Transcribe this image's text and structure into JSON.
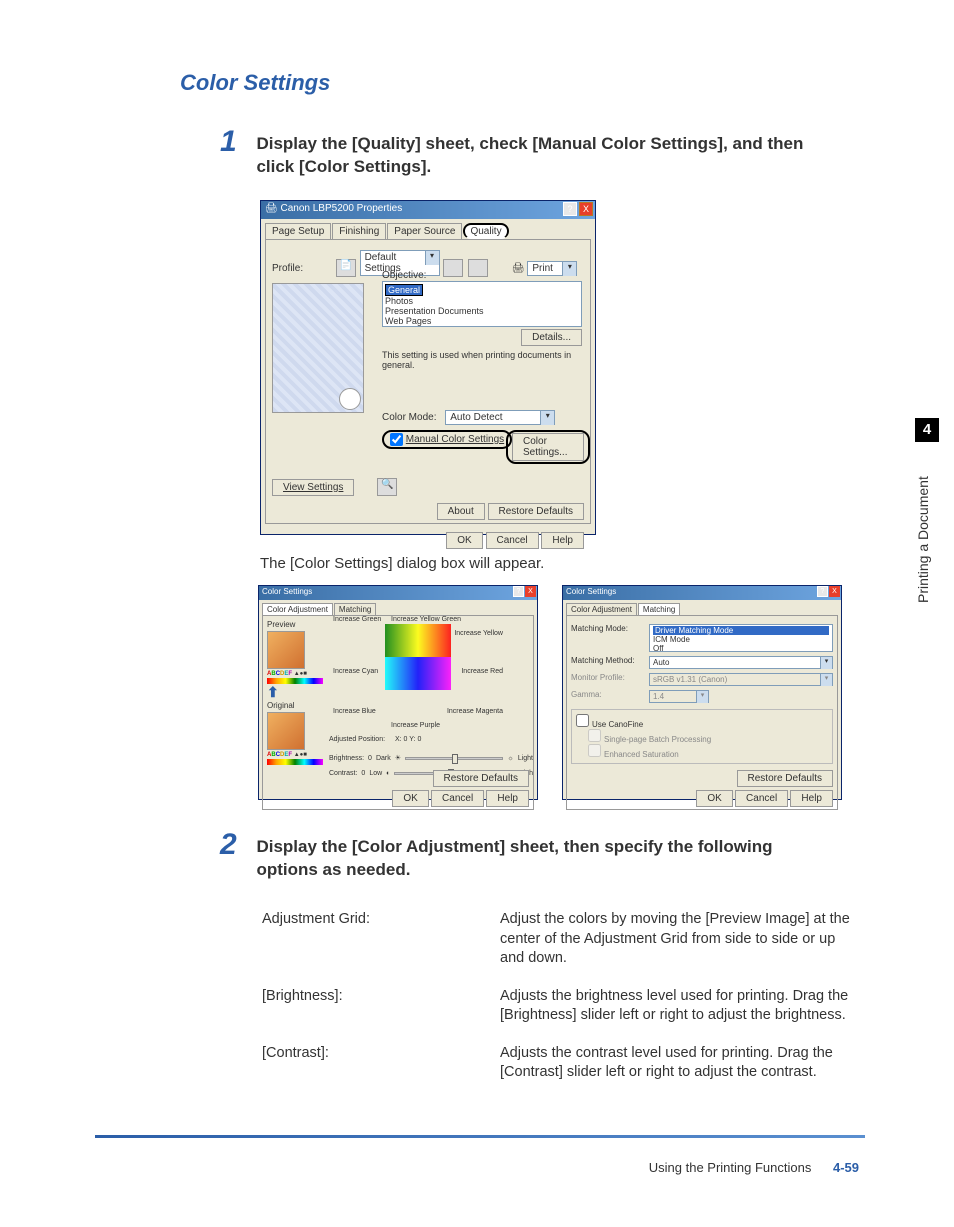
{
  "page_title": "Color Settings",
  "chapter_num": "4",
  "side_text": "Printing a Document",
  "step1": {
    "num": "1",
    "text": "Display the [Quality] sheet, check [Manual Color Settings], and then click [Color Settings]."
  },
  "dialog1": {
    "title": "Canon LBP5200 Properties",
    "help": "?",
    "close": "X",
    "tabs": {
      "page_setup": "Page Setup",
      "finishing": "Finishing",
      "paper_source": "Paper Source",
      "quality": "Quality"
    },
    "profile_label": "Profile:",
    "profile_value": "Default Settings",
    "print_label": "Print",
    "objective_label": "Objective:",
    "objective_items": {
      "general": "General",
      "photos": "Photos",
      "presentation": "Presentation Documents",
      "web": "Web Pages"
    },
    "details_btn": "Details...",
    "setting_note": "This setting is used when printing documents in general.",
    "colormode_label": "Color Mode:",
    "colormode_value": "Auto Detect",
    "manual_check": "Manual Color Settings",
    "colorsettings_btn": "Color Settings...",
    "view_settings": "View Settings",
    "about_btn": "About",
    "restore_btn": "Restore Defaults",
    "ok_btn": "OK",
    "cancel_btn": "Cancel",
    "help_btn": "Help"
  },
  "caption1": "The [Color Settings] dialog box will appear.",
  "ss1": {
    "title": "Color Settings",
    "tab_ca": "Color Adjustment",
    "tab_m": "Matching",
    "preview": "Preview",
    "original": "Original",
    "inc_yg": "Increase Yellow Green",
    "inc_green": "Increase Green",
    "inc_yellow": "Increase Yellow",
    "inc_cyan": "Increase Cyan",
    "inc_red": "Increase Red",
    "inc_blue": "Increase Blue",
    "inc_magenta": "Increase Magenta",
    "inc_purple": "Increase Purple",
    "adj_pos": "Adjusted Position:",
    "xy": "X: 0    Y: 0",
    "brightness": "Brightness:",
    "b_val": "0",
    "dark": "Dark",
    "light": "Light",
    "contrast": "Contrast:",
    "c_val": "0",
    "low": "Low",
    "high": "High",
    "restore": "Restore Defaults",
    "ok": "OK",
    "cancel": "Cancel",
    "help": "Help"
  },
  "ss2": {
    "title": "Color Settings",
    "tab_ca": "Color Adjustment",
    "tab_m": "Matching",
    "mmode": "Matching Mode:",
    "mmode_sel": "Driver Matching Mode",
    "mmode_2": "ICM Mode",
    "mmode_3": "Off",
    "mmethod": "Matching Method:",
    "mmethod_val": "Auto",
    "mprofile": "Monitor Profile:",
    "mprofile_val": "sRGB v1.31 (Canon)",
    "gamma": "Gamma:",
    "gamma_val": "1.4",
    "canofine": "Use CanoFine",
    "single": "Single-page Batch Processing",
    "enh": "Enhanced Saturation",
    "restore": "Restore Defaults",
    "ok": "OK",
    "cancel": "Cancel",
    "help": "Help"
  },
  "step2": {
    "num": "2",
    "text": "Display the [Color Adjustment] sheet, then specify the following options as needed."
  },
  "options": {
    "r1l": "Adjustment Grid:",
    "r1r": "Adjust the colors by moving the [Preview Image] at the center of the Adjustment Grid from side to side or up and down.",
    "r2l": "[Brightness]:",
    "r2r": "Adjusts the brightness level used for printing. Drag the [Brightness] slider left or right to adjust the brightness.",
    "r3l": "[Contrast]:",
    "r3r": "Adjusts the contrast level used for printing. Drag the [Contrast] slider left or right to adjust the contrast."
  },
  "footer": {
    "section": "Using the Printing Functions",
    "page": "4-59"
  }
}
